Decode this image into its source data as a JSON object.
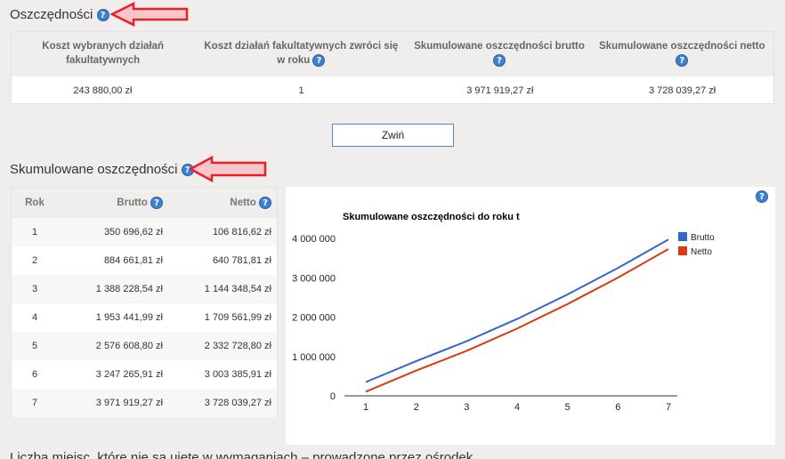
{
  "section1": {
    "title": "Oszczędności"
  },
  "summary": {
    "headers": [
      "Koszt wybranych działań fakultatywnych",
      "Koszt działań fakultatywnych zwróci się w roku",
      "Skumulowane oszczędności brutto",
      "Skumulowane oszczędności netto"
    ],
    "values": [
      "243 880,00 zł",
      "1",
      "3 971 919,27 zł",
      "3 728 039,27 zł"
    ]
  },
  "collapse_button": "Zwiń",
  "section2": {
    "title": "Skumulowane oszczędności"
  },
  "year_table": {
    "headers": {
      "rok": "Rok",
      "brutto": "Brutto",
      "netto": "Netto"
    },
    "rows": [
      {
        "rok": "1",
        "brutto": "350 696,62 zł",
        "netto": "106 816,62 zł"
      },
      {
        "rok": "2",
        "brutto": "884 661,81 zł",
        "netto": "640 781,81 zł"
      },
      {
        "rok": "3",
        "brutto": "1 388 228,54 zł",
        "netto": "1 144 348,54 zł"
      },
      {
        "rok": "4",
        "brutto": "1 953 441,99 zł",
        "netto": "1 709 561,99 zł"
      },
      {
        "rok": "5",
        "brutto": "2 576 608,80 zł",
        "netto": "2 332 728,80 zł"
      },
      {
        "rok": "6",
        "brutto": "3 247 265,91 zł",
        "netto": "3 003 385,91 zł"
      },
      {
        "rok": "7",
        "brutto": "3 971 919,27 zł",
        "netto": "3 728 039,27 zł"
      }
    ]
  },
  "help_glyph": "?",
  "bottom_text": "Liczba miejsc, które nie są ujęte w wymaganiach – prowadzone przez ośrodek",
  "colors": {
    "brutto": "#3366cc",
    "netto": "#dc3912",
    "arrow": "#e8202a",
    "help": "#3d7fd1"
  },
  "chart_data": {
    "type": "line",
    "title": "Skumulowane oszczędności do roku t",
    "x": [
      1,
      2,
      3,
      4,
      5,
      6,
      7
    ],
    "series": [
      {
        "name": "Brutto",
        "values": [
          350696.62,
          884661.81,
          1388228.54,
          1953441.99,
          2576608.8,
          3247265.91,
          3971919.27
        ]
      },
      {
        "name": "Netto",
        "values": [
          106816.62,
          640781.81,
          1144348.54,
          1709561.99,
          2332728.8,
          3003385.91,
          3728039.27
        ]
      }
    ],
    "yticks": [
      0,
      1000000,
      2000000,
      3000000,
      4000000
    ],
    "ytick_labels": [
      "0",
      "1 000 000",
      "2 000 000",
      "3 000 000",
      "4 000 000"
    ],
    "ylim": [
      0,
      4000000
    ],
    "xlim": [
      1,
      7
    ],
    "legend": "right",
    "grid": false
  }
}
